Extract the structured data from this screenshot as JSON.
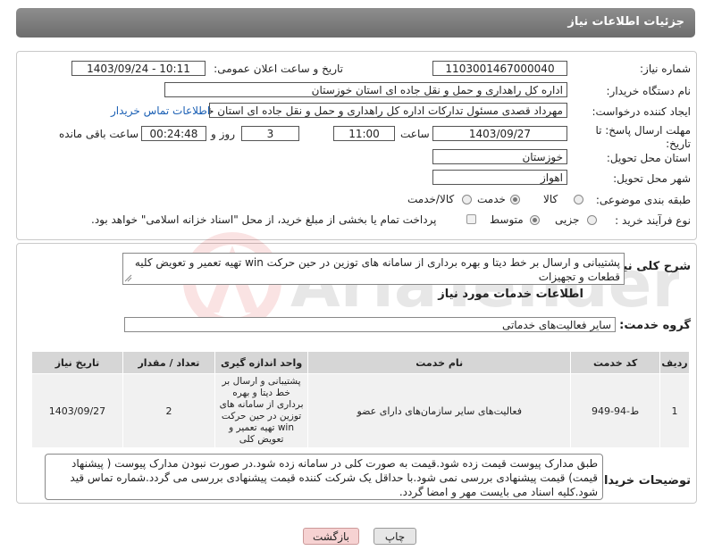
{
  "header": {
    "title": "جزئیات اطلاعات نیاز"
  },
  "labels": {
    "need_number": "شماره نیاز:",
    "announce_datetime": "تاریخ و ساعت اعلان عمومی:",
    "buyer_org": "نام دستگاه خریدار:",
    "requester": "ایجاد کننده درخواست:",
    "deadline": "مهلت ارسال پاسخ: تا تاریخ:",
    "time_word": "ساعت",
    "day_word": "روز و",
    "remaining": "ساعت باقی مانده",
    "province": "استان محل تحویل:",
    "city": "شهر محل تحویل:",
    "category": "طبقه بندی موضوعی:",
    "process_type": "نوع فرآیند خرید :",
    "description": "شرح کلی نیاز:",
    "services_info": "اطلاعات خدمات مورد نیاز",
    "service_group": "گروه خدمت:",
    "buyer_notes": "توضیحات خریدار:"
  },
  "values": {
    "need_number": "1103001467000040",
    "announce_datetime": "1403/09/24 - 10:11",
    "buyer_org": "اداره کل راهداری و حمل و نقل جاده ای استان خوزستان",
    "requester": "مهرداد قصدی مسئول تداركات اداره کل راهداری و حمل و نقل جاده ای استان خو",
    "contact_link": "اطلاعات تماس خریدار",
    "deadline_date": "1403/09/27",
    "deadline_time": "11:00",
    "days": "3",
    "remaining_time": "00:24:48",
    "province": "خوزستان",
    "city": "اهواز",
    "description": "پشتیبانی و ارسال بر خط دیتا و بهره برداری از سامانه های توزین در حین حرکت win تهیه تعمیر و تعویض کلیه قطعات و تجهیزات",
    "service_group": "سایر فعالیت‌های خدماتی",
    "buyer_notes": "طبق مدارک پیوست قیمت زده شود.قیمت به صورت کلی در سامانه زده شود.در صورت نبودن مدارک پیوست ( پیشنهاد قیمت) قیمت پیشنهادی بررسی نمی شود.با حداقل یک شرکت کننده قیمت پیشنهادی بررسی می گردد.شماره تماس قید شود.کلیه اسناد می بایست مهر و امضا گردد."
  },
  "category_options": [
    {
      "label": "کالا",
      "selected": false
    },
    {
      "label": "خدمت",
      "selected": true
    },
    {
      "label": "کالا/خدمت",
      "selected": false
    }
  ],
  "process_options": [
    {
      "label": "جزیی",
      "selected": false
    },
    {
      "label": "متوسط",
      "selected": true
    }
  ],
  "payment_note": "پرداخت تمام یا بخشی از مبلغ خرید، از محل \"اسناد خزانه اسلامی\" خواهد بود.",
  "table": {
    "headers": [
      "ردیف",
      "کد خدمت",
      "نام خدمت",
      "واحد اندازه گیری",
      "تعداد / مقدار",
      "تاریخ نیاز"
    ],
    "rows": [
      [
        "1",
        "ط-94-949",
        "فعالیت‌های سایر سازمان‌های دارای عضو",
        "پشتیبانی و ارسال بر خط دیتا و بهره برداری از سامانه های توزین در حین حرکت win تهیه تعمیر و تعویض کلی",
        "2",
        "1403/09/27"
      ]
    ]
  },
  "buttons": {
    "print": "چاپ",
    "back": "بازگشت"
  },
  "watermark": {
    "text": "AriaTender.neT"
  },
  "colors": {
    "header_bg": "#7a7a7a",
    "link": "#1a5fb4",
    "back_button_bg": "#f6d2d2",
    "print_button_bg": "#e6e6e6"
  }
}
